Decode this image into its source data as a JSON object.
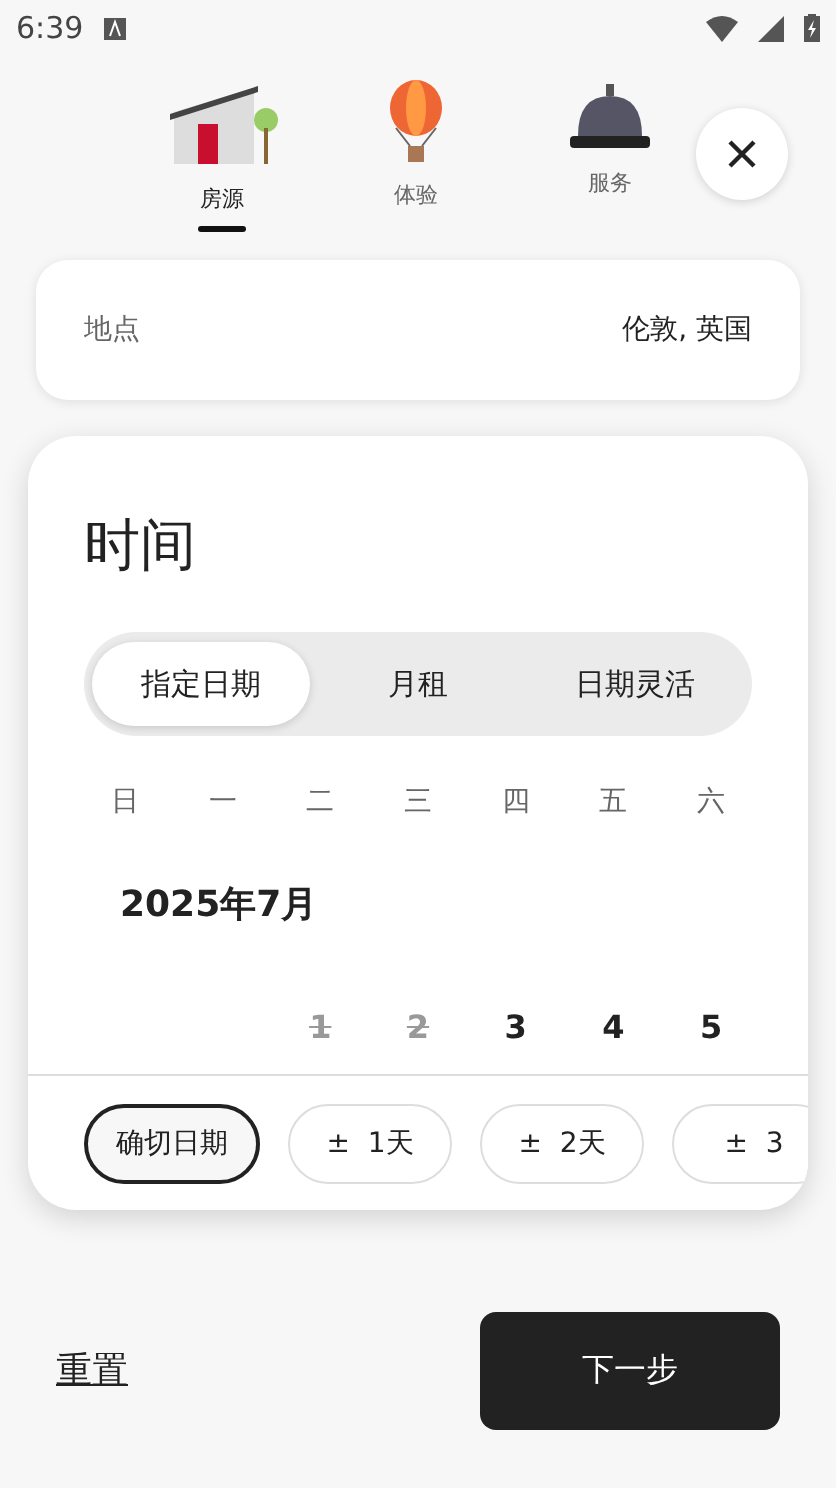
{
  "status_bar": {
    "time": "6:39"
  },
  "tabs": [
    {
      "label": "房源",
      "selected": true,
      "kind": "house"
    },
    {
      "label": "体验",
      "selected": false,
      "kind": "balloon"
    },
    {
      "label": "服务",
      "selected": false,
      "kind": "bell"
    }
  ],
  "location": {
    "label": "地点",
    "value": "伦敦, 英国"
  },
  "time_card": {
    "title": "时间",
    "modes": [
      {
        "label": "指定日期",
        "selected": true
      },
      {
        "label": "月租",
        "selected": false
      },
      {
        "label": "日期灵活",
        "selected": false
      }
    ],
    "weekdays": [
      "日",
      "一",
      "二",
      "三",
      "四",
      "五",
      "六"
    ],
    "month": "2025年7月",
    "days": [
      {
        "kind": "empty"
      },
      {
        "kind": "empty"
      },
      {
        "kind": "day",
        "label": "1",
        "disabled": true
      },
      {
        "kind": "day",
        "label": "2",
        "disabled": true
      },
      {
        "kind": "day",
        "label": "3",
        "disabled": false
      },
      {
        "kind": "day",
        "label": "4",
        "disabled": false
      },
      {
        "kind": "day",
        "label": "5",
        "disabled": false
      }
    ],
    "flex_options": [
      {
        "label": "确切日期",
        "selected": true
      },
      {
        "label": "±  1天",
        "selected": false
      },
      {
        "label": "±  2天",
        "selected": false
      },
      {
        "label": "±  3",
        "selected": false
      }
    ]
  },
  "footer": {
    "reset": "重置",
    "next": "下一步"
  }
}
